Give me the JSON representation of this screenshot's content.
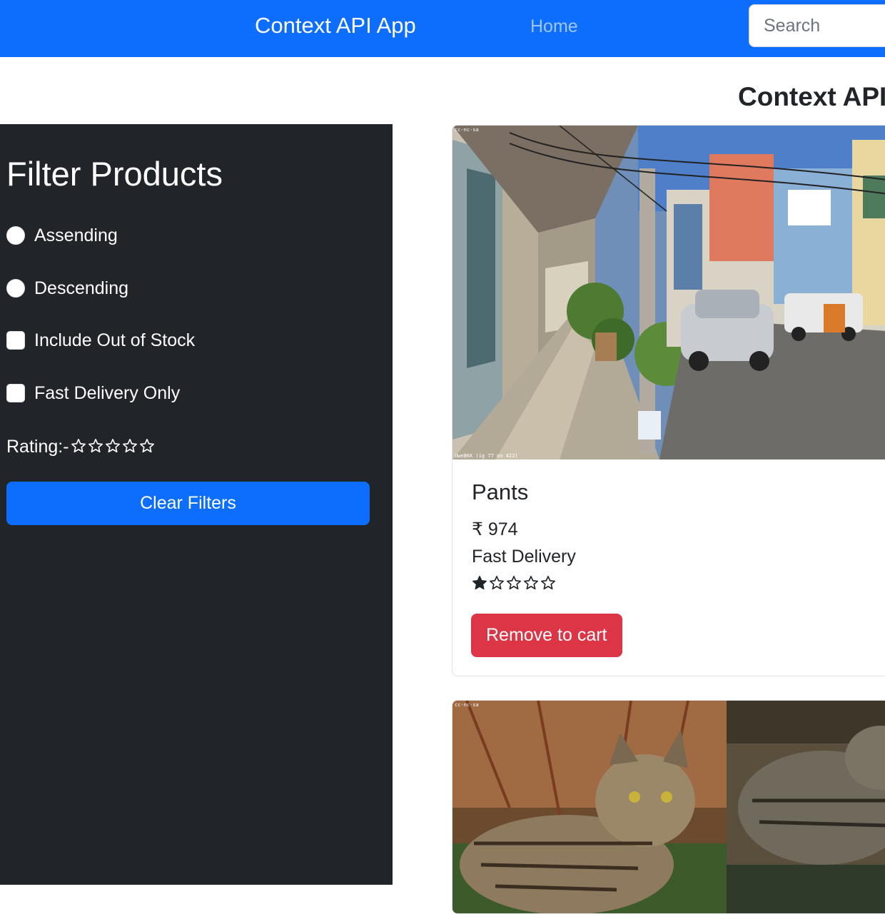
{
  "navbar": {
    "brand": "Context API App",
    "home_link": "Home",
    "search_placeholder": "Search",
    "background_color": "#0d6efd"
  },
  "page_title": "Context API",
  "sidebar": {
    "title": "Filter Products",
    "options": [
      {
        "type": "radio",
        "label": "Assending",
        "checked": false
      },
      {
        "type": "radio",
        "label": "Descending",
        "checked": false
      },
      {
        "type": "checkbox",
        "label": "Include Out of Stock",
        "checked": false
      },
      {
        "type": "checkbox",
        "label": "Fast Delivery Only",
        "checked": false
      }
    ],
    "rating_label": "Rating:-",
    "rating_value": 0,
    "rating_max": 5,
    "clear_button": "Clear Filters",
    "background_color": "#212529"
  },
  "products": [
    {
      "name": "Pants",
      "price": "₹ 974",
      "delivery": "Fast Delivery",
      "rating": 1,
      "rating_max": 5,
      "button": "Remove to cart",
      "button_color": "#dc3545",
      "image_subject": "street scene with shophouses, parked car and pickup truck",
      "image_credit_top": "cc-nc-sa",
      "image_credit_bottom": "UweBKK (ig 77 on 422)"
    },
    {
      "image_subject": "tabby cats outdoors",
      "image_credit_top": "cc-nc-sa"
    }
  ]
}
